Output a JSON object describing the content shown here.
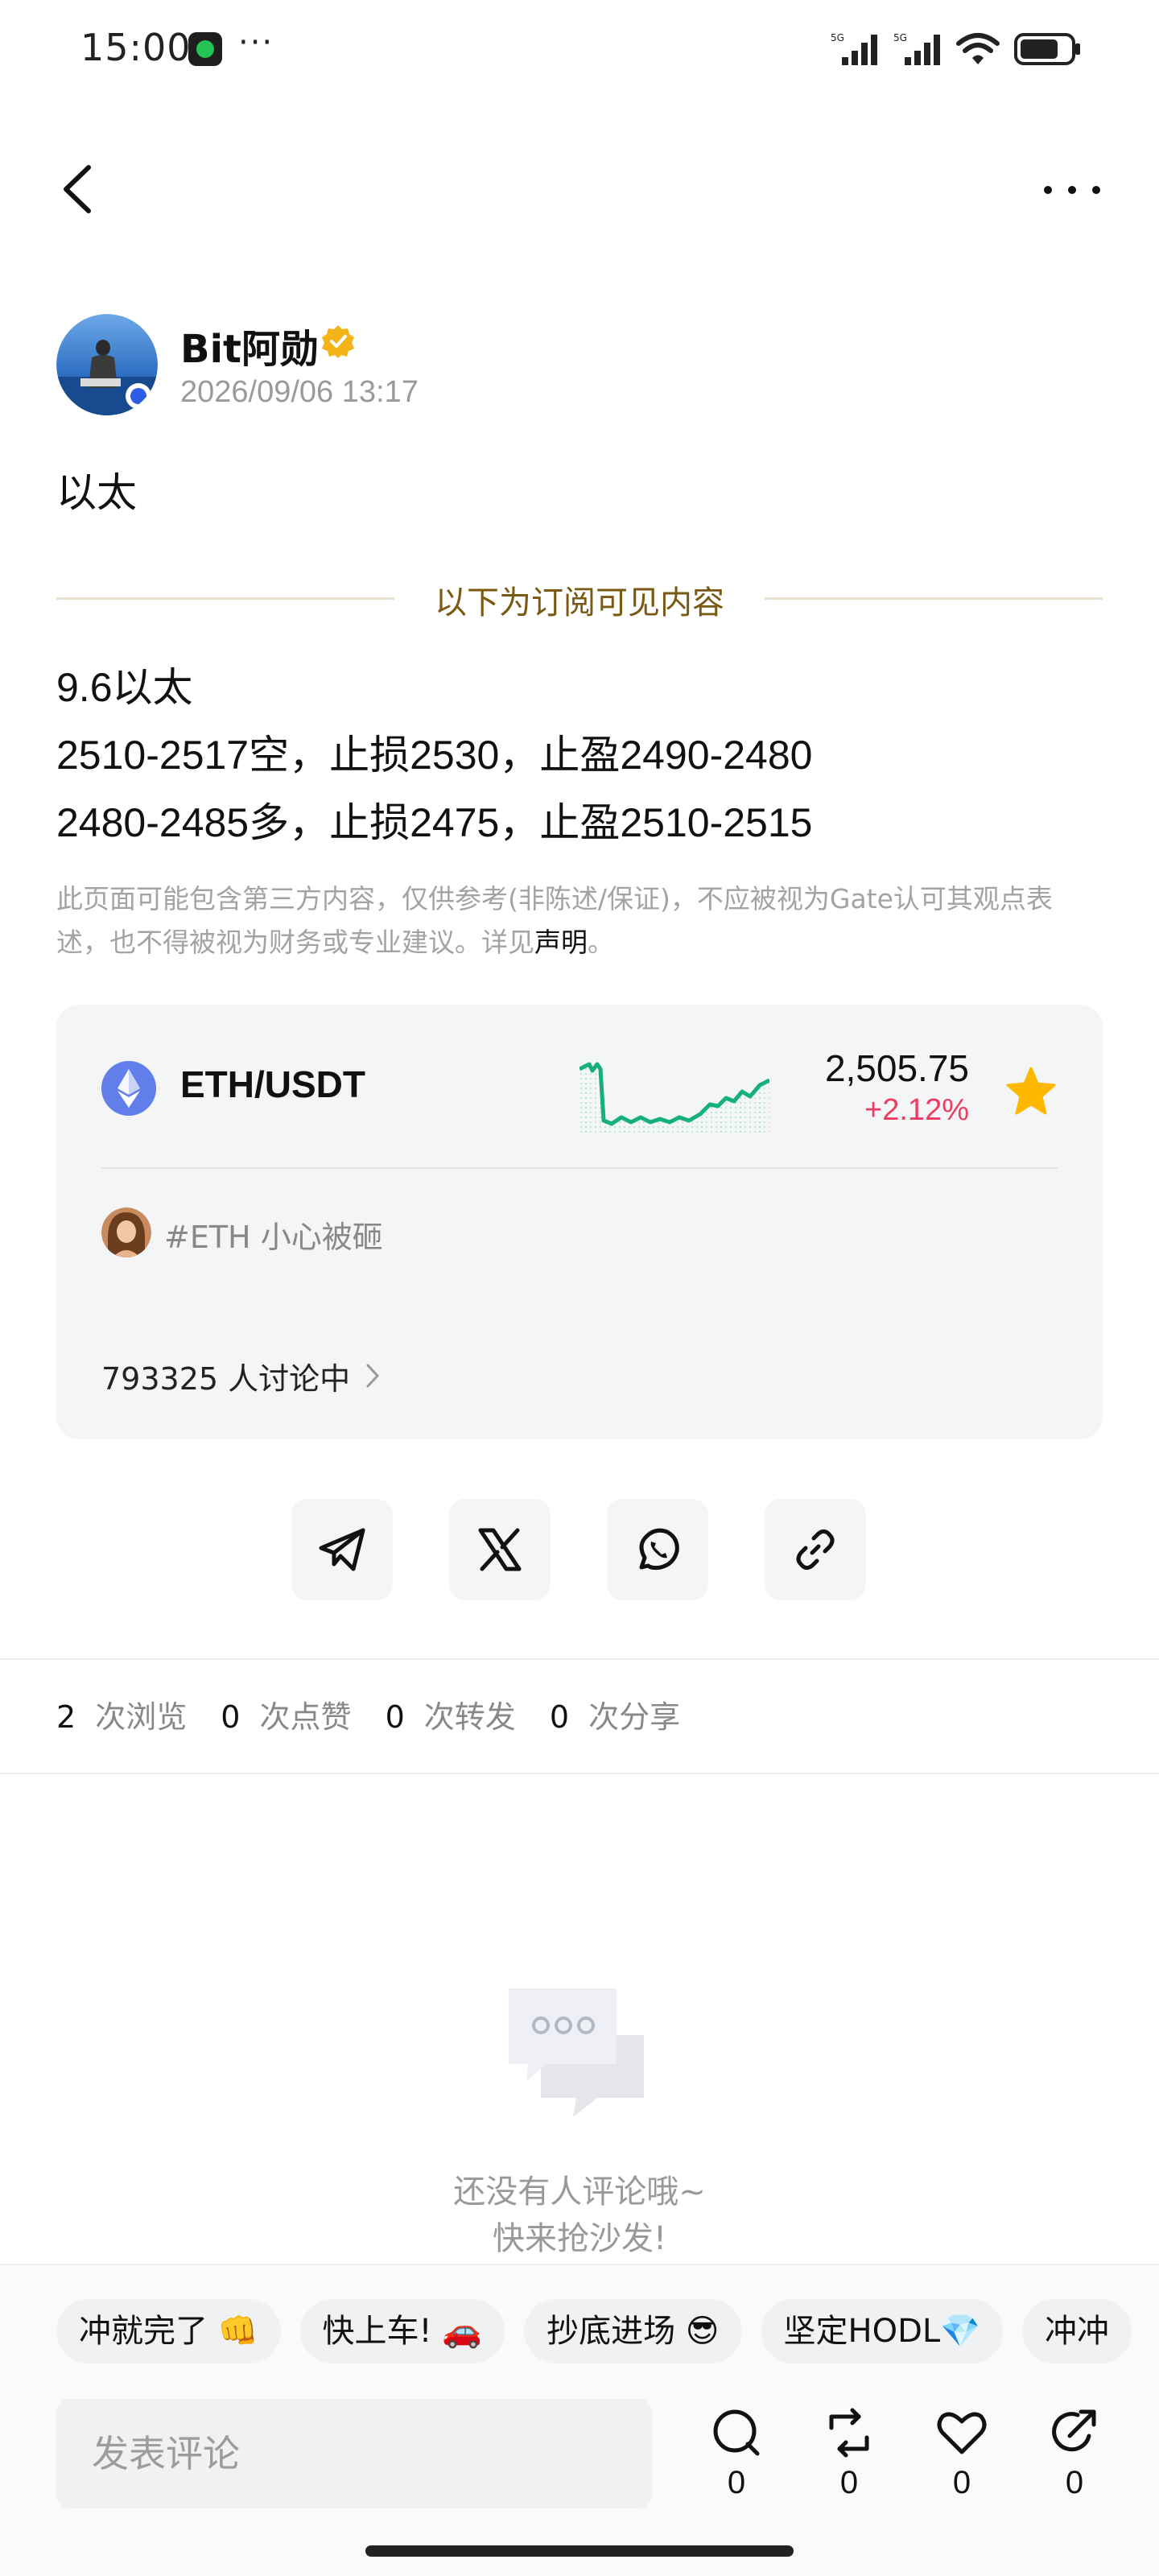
{
  "status_bar": {
    "time": "15:00",
    "more": "···"
  },
  "author": {
    "name": "Bit阿勋",
    "time": "2026/09/06 13:17"
  },
  "post": {
    "title": "以太",
    "subscription_notice": "以下为订阅可见内容",
    "lines": [
      "9.6以太",
      "2510-2517空，止损2530，止盈2490-2480",
      "2480-2485多，止损2475，止盈2510-2515"
    ],
    "disclaimer": "此页面可能包含第三方内容，仅供参考(非陈述/保证)，不应被视为Gate认可其观点表述，也不得被视为财务或专业建议。详见",
    "disclaimer_link": "声明",
    "disclaimer_end": "。"
  },
  "market": {
    "pair": "ETH/USDT",
    "price": "2,505.75",
    "change": "+2.12%",
    "topic": "#ETH 小心被砸",
    "discussion": "793325 人讨论中",
    "colors": {
      "up": "#16b07a",
      "change": "#f03b63",
      "star": "#ffb800",
      "eth": "#627eea"
    }
  },
  "share": {
    "items": [
      "telegram-icon",
      "x-icon",
      "whatsapp-icon",
      "link-icon"
    ]
  },
  "stats": [
    {
      "num": "2",
      "label": "次浏览"
    },
    {
      "num": "0",
      "label": "次点赞"
    },
    {
      "num": "0",
      "label": "次转发"
    },
    {
      "num": "0",
      "label": "次分享"
    }
  ],
  "empty": {
    "line1": "还没有人评论哦~",
    "line2": "快来抢沙发!"
  },
  "chips": [
    "冲就完了 👊",
    "快上车! 🚗",
    "抄底进场 😎",
    "坚定HODL💎",
    "冲冲"
  ],
  "comment": {
    "placeholder": "发表评论"
  },
  "actions": [
    {
      "icon": "comment-icon",
      "count": "0"
    },
    {
      "icon": "repost-icon",
      "count": "0"
    },
    {
      "icon": "heart-icon",
      "count": "0"
    },
    {
      "icon": "share-icon",
      "count": "0"
    }
  ]
}
